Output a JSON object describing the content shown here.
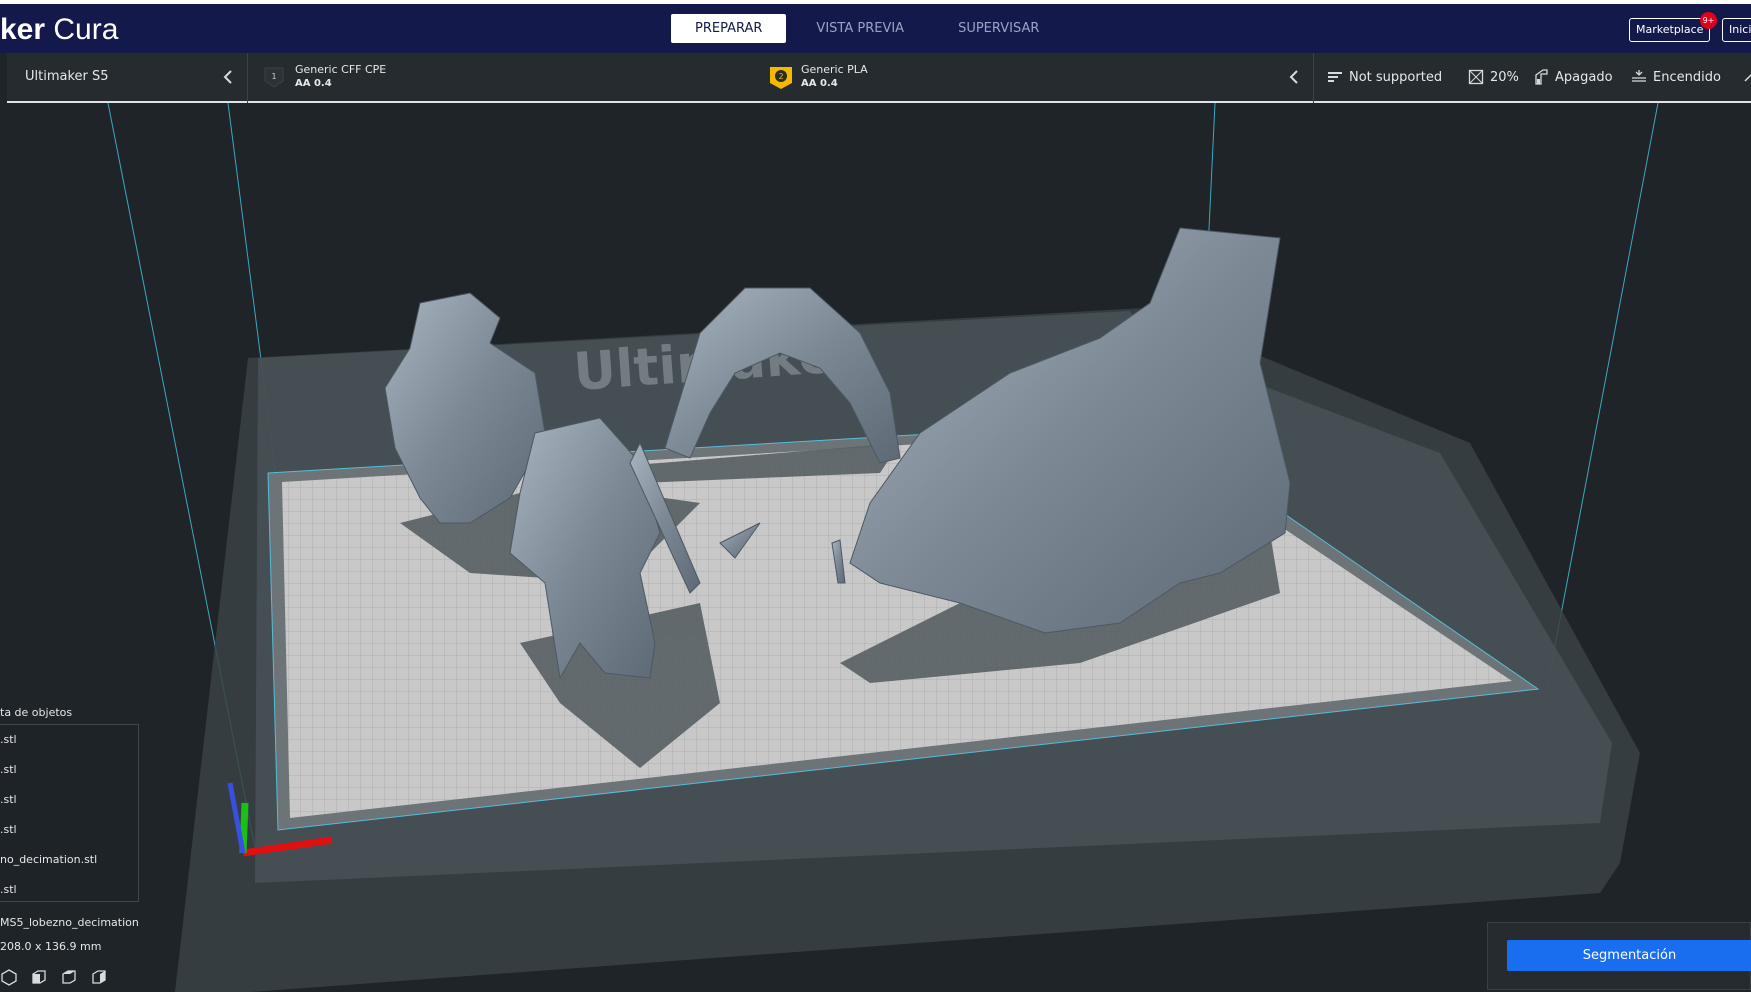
{
  "app": {
    "logo_bold": "ker",
    "logo_light": "Cura"
  },
  "stages": {
    "prepare": "PREPARAR",
    "preview": "VISTA PREVIA",
    "monitor": "SUPERVISAR"
  },
  "header": {
    "marketplace_label": "Marketplace",
    "marketplace_badge": "9+",
    "signin_label": "Inici"
  },
  "printer": {
    "name": "Ultimaker S5"
  },
  "extruders": [
    {
      "number": "1",
      "material": "Generic CFF CPE",
      "nozzle": "AA 0.4"
    },
    {
      "number": "2",
      "material": "Generic PLA",
      "nozzle": "AA 0.4"
    }
  ],
  "print_settings": {
    "profile": "Not supported",
    "infill": "20%",
    "support": "Apagado",
    "adhesion": "Encendido"
  },
  "viewport": {
    "plate_logo_text": "Ultimaker"
  },
  "object_list": {
    "title": "ta de objetos",
    "items": [
      ".stl",
      ".stl",
      ".stl",
      ".stl",
      "no_decimation.stl",
      ".stl"
    ],
    "selected_name": "MS5_lobezno_decimation",
    "dimensions": "208.0 x 136.9 mm"
  },
  "slice": {
    "button_label": "Segmentación"
  },
  "colors": {
    "header_bg": "#13194a",
    "toolbar_bg": "#252b2e",
    "viewport_bg": "#1e2427",
    "accent_blue": "#196ef0",
    "badge_red": "#e0001b",
    "extruder2_yellow": "#f3ba00"
  }
}
